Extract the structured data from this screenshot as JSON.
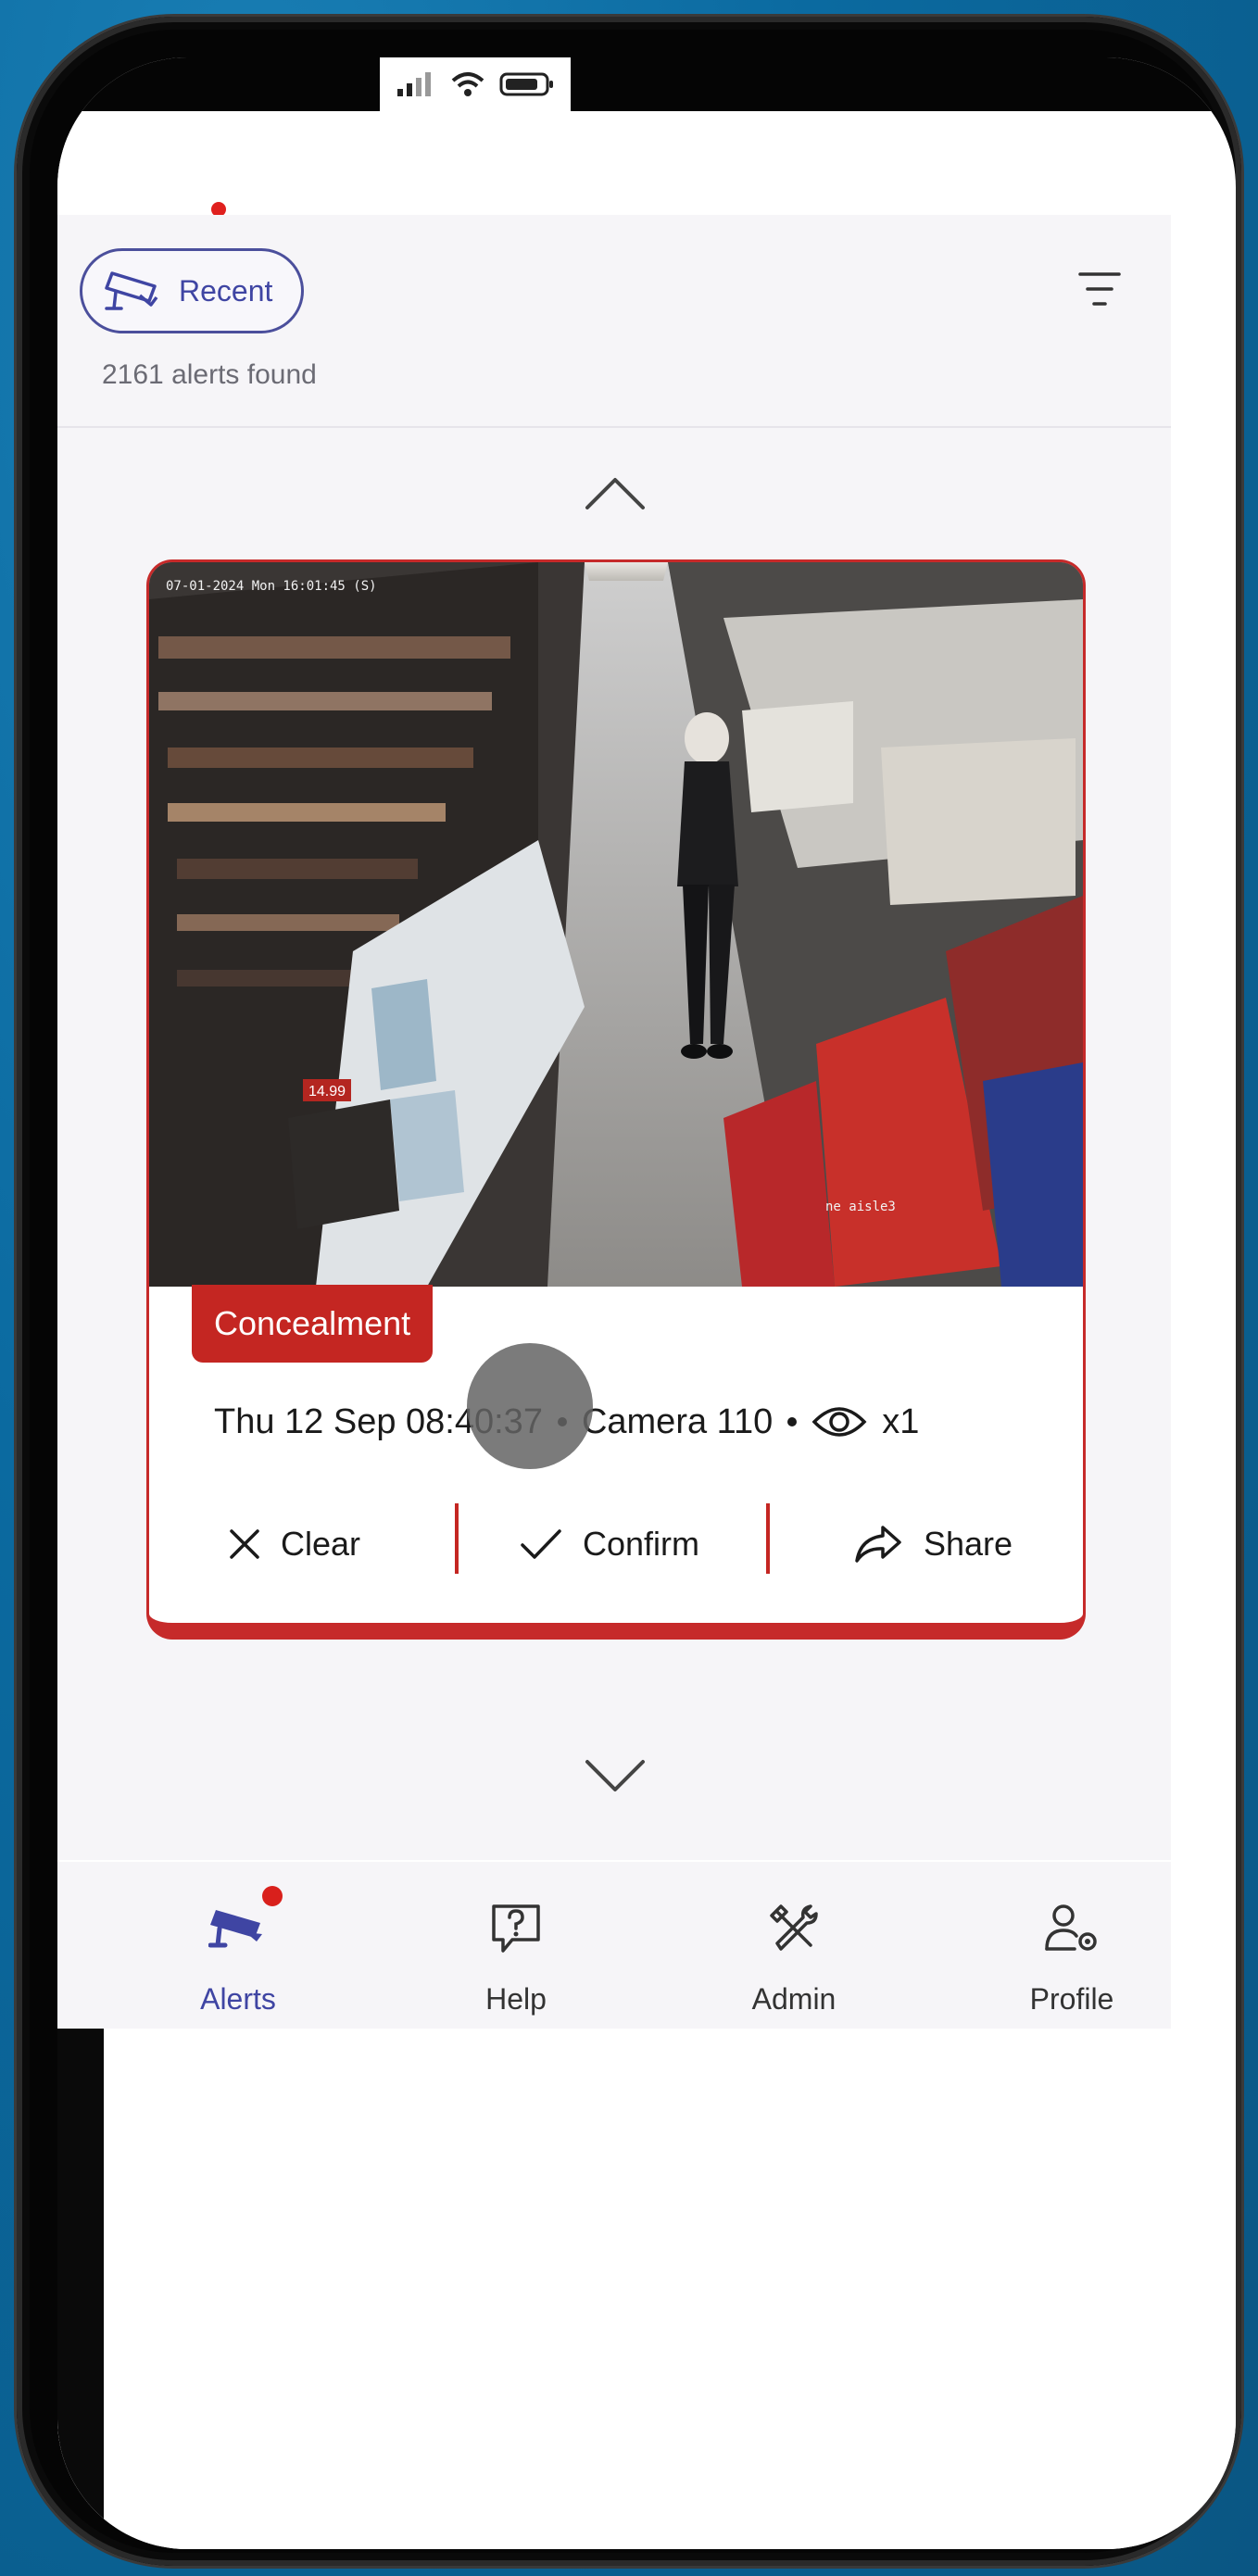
{
  "header": {
    "recent_label": "Recent",
    "alerts_found": "2161 alerts found"
  },
  "alert": {
    "type_tag": "Concealment",
    "datetime": "Thu 12 Sep 08:40:37",
    "camera": "Camera 110",
    "views": "x1",
    "osd_timestamp": "07-01-2024 Mon 16:01:45 (S)",
    "osd_location": "ne aisle3",
    "price_tag": "14.99"
  },
  "actions": {
    "clear": "Clear",
    "confirm": "Confirm",
    "share": "Share"
  },
  "tabs": [
    {
      "label": "Alerts",
      "icon": "cctv-camera-icon",
      "active": true
    },
    {
      "label": "Help",
      "icon": "help-chat-icon",
      "active": false
    },
    {
      "label": "Admin",
      "icon": "tools-icon",
      "active": false
    },
    {
      "label": "Profile",
      "icon": "user-settings-icon",
      "active": false
    }
  ],
  "colors": {
    "accent": "#3f45a3",
    "alert_red": "#c42622",
    "background": "#f6f5f8"
  }
}
